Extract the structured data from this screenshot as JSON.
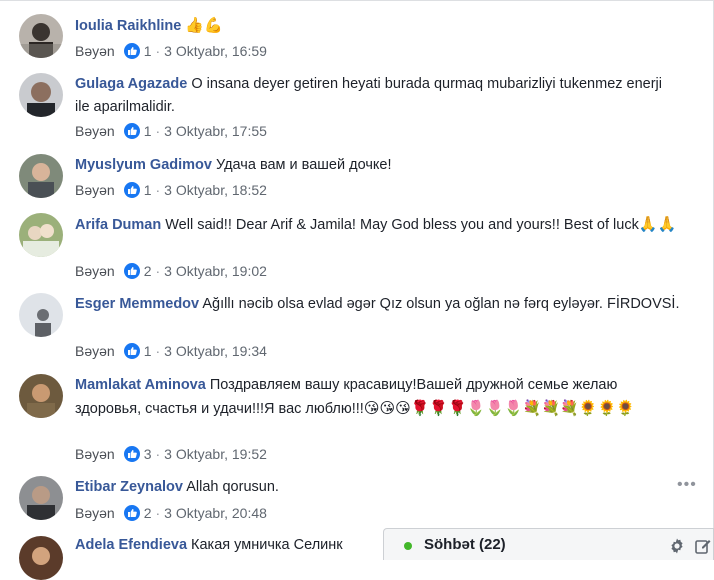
{
  "comments": [
    {
      "name": "Ioulia Raikhline",
      "text": "",
      "emoji": "👍💪",
      "like_label": "Bəyən",
      "likes": "1",
      "time": "3 Oktyabr, 16:59"
    },
    {
      "name": "Gulaga Agazade",
      "text": "O insana deyer getiren heyati burada qurmaq mubarizliyi tukenmez enerji ile aparilmalidir.",
      "emoji": "",
      "like_label": "Bəyən",
      "likes": "1",
      "time": "3 Oktyabr, 17:55"
    },
    {
      "name": "Myuslyum Gadimov",
      "text": "Удача вам и вашей дочке!",
      "emoji": "",
      "like_label": "Bəyən",
      "likes": "1",
      "time": "3 Oktyabr, 18:52"
    },
    {
      "name": "Arifa Duman",
      "text": "Well said!! Dear Arif & Jamila! May God bless you and yours!! Best of luck",
      "emoji": "🙏🙏",
      "like_label": "Bəyən",
      "likes": "2",
      "time": "3 Oktyabr, 19:02"
    },
    {
      "name": "Esger Memmedov",
      "text": "Ağıllı nəcib olsa evlad əgər Qız olsun ya oğlan nə fərq eyləyər. FİRDOVSİ.",
      "emoji": "",
      "like_label": "Bəyən",
      "likes": "1",
      "time": "3 Oktyabr, 19:34"
    },
    {
      "name": "Mamlakat Aminova",
      "text": "Поздравляем вашу красавицу!Вашей дружной семье желаю здоровья, счастья и удачи!!!Я вас люблю!!!",
      "emoji": "😘😘😘🌹🌹🌹🌷🌷🌷💐💐💐🌻🌻🌻",
      "like_label": "Bəyən",
      "likes": "3",
      "time": "3 Oktyabr, 19:52"
    },
    {
      "name": "Etibar Zeynalov",
      "text": "Allah qorusun.",
      "emoji": "",
      "like_label": "Bəyən",
      "likes": "2",
      "time": "3 Oktyabr, 20:48"
    },
    {
      "name": "Adela Efendieva",
      "text": "Какая умничка Селинк",
      "emoji": "",
      "like_label": "",
      "likes": "",
      "time": ""
    }
  ],
  "chat": {
    "label": "Söhbət (22)"
  },
  "more_options": "•••",
  "separator": "·",
  "colors": {
    "link": "#385898",
    "like_blue": "#1877f2",
    "online_green": "#42b72a",
    "meta_gray": "#606770"
  },
  "icons": [
    "like-icon",
    "more-options-icon",
    "gear-icon",
    "compose-icon",
    "online-indicator"
  ]
}
